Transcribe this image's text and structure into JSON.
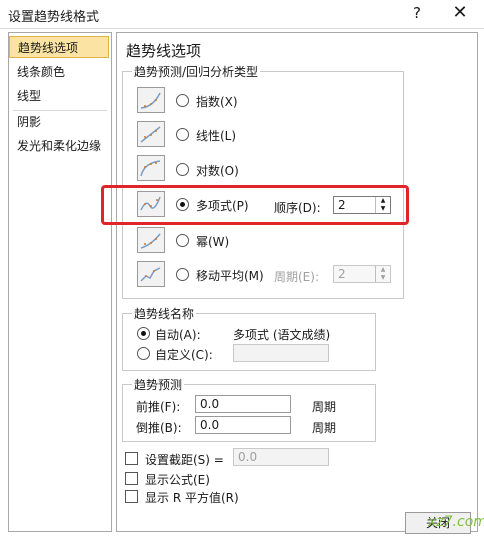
{
  "window": {
    "title": "设置趋势线格式",
    "help_glyph": "?",
    "close_glyph": "✕"
  },
  "sidebar": {
    "items": [
      {
        "label": "趋势线选项",
        "active": true
      },
      {
        "label": "线条颜色",
        "active": false
      },
      {
        "label": "线型",
        "active": false
      },
      {
        "label": "阴影",
        "active": false
      },
      {
        "label": "发光和柔化边缘",
        "active": false
      }
    ]
  },
  "panel": {
    "heading": "趋势线选项",
    "type_group": {
      "label": "趋势预测/回归分析类型",
      "options": [
        {
          "label": "指数(X)",
          "icon": "exponential-trendline-icon",
          "checked": false
        },
        {
          "label": "线性(L)",
          "icon": "linear-trendline-icon",
          "checked": false
        },
        {
          "label": "对数(O)",
          "icon": "logarithmic-trendline-icon",
          "checked": false
        },
        {
          "label": "多项式(P)",
          "icon": "polynomial-trendline-icon",
          "checked": true
        },
        {
          "label": "幂(W)",
          "icon": "power-trendline-icon",
          "checked": false
        },
        {
          "label": "移动平均(M)",
          "icon": "moving-average-trendline-icon",
          "checked": false
        }
      ],
      "order": {
        "label": "顺序(D):",
        "value": "2"
      },
      "period": {
        "label": "周期(E):",
        "value": "2",
        "disabled": true
      }
    },
    "name_group": {
      "label": "趋势线名称",
      "auto": {
        "label": "自动(A):",
        "value": "多项式 (语文成绩)",
        "checked": true
      },
      "custom": {
        "label": "自定义(C):",
        "value": "",
        "checked": false
      }
    },
    "forecast_group": {
      "label": "趋势预测",
      "forward": {
        "label": "前推(F):",
        "value": "0.0",
        "unit": "周期"
      },
      "backward": {
        "label": "倒推(B):",
        "value": "0.0",
        "unit": "周期"
      }
    },
    "intercept": {
      "label": "设置截距(S) =",
      "value": "0.0",
      "checked": false
    },
    "display_equation": {
      "label": "显示公式(E)",
      "checked": false
    },
    "display_r2": {
      "label": "显示 R 平方值(R)",
      "checked": false
    }
  },
  "close_button": {
    "label": "关闭"
  },
  "watermark": "xz7.com",
  "colors": {
    "highlight": "#e0242a",
    "active_item": "#fbe4a3"
  }
}
